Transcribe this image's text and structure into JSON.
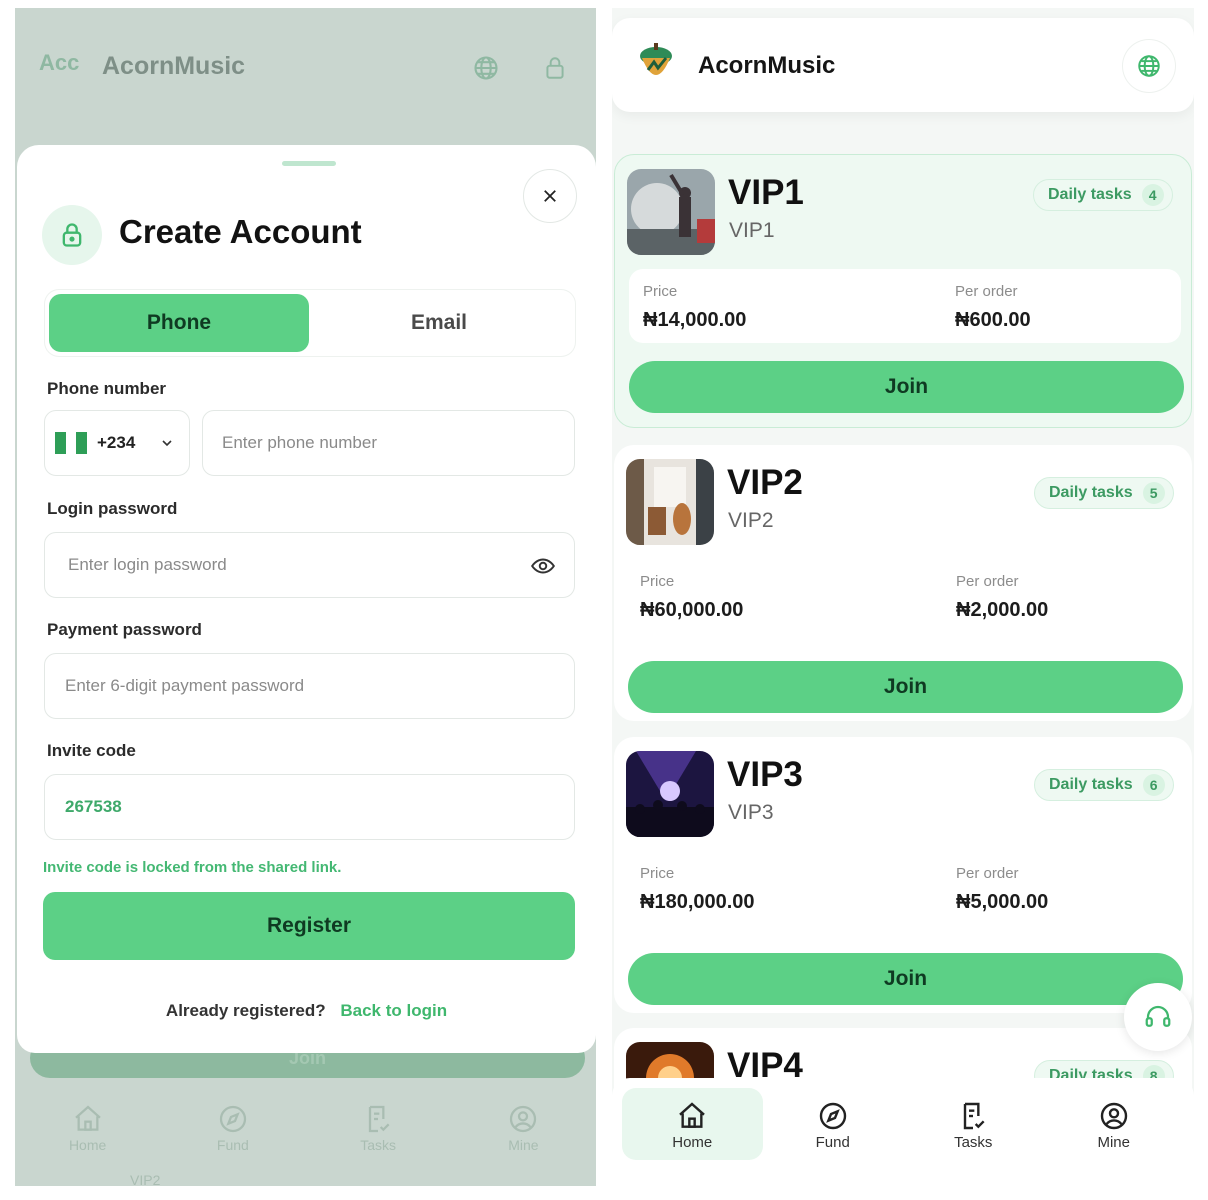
{
  "left": {
    "background": {
      "logo_text": "Acc",
      "app_title": "AcornMusic",
      "join_label": "Join",
      "nav": [
        {
          "label": "Home",
          "icon": "home-icon"
        },
        {
          "label": "Fund",
          "icon": "compass-icon"
        },
        {
          "label": "Tasks",
          "icon": "tasks-icon"
        },
        {
          "label": "Mine",
          "icon": "user-circle-icon"
        }
      ],
      "footer_text": "VIP2"
    },
    "modal": {
      "title": "Create Account",
      "tabs": [
        {
          "label": "Phone",
          "active": true
        },
        {
          "label": "Email",
          "active": false
        }
      ],
      "phone_label": "Phone number",
      "country_code": "+234",
      "phone_placeholder": "Enter phone number",
      "login_password_label": "Login password",
      "login_password_placeholder": "Enter login password",
      "payment_password_label": "Payment password",
      "payment_password_placeholder": "Enter 6-digit payment password",
      "invite_label": "Invite code",
      "invite_value": "267538",
      "invite_note": "Invite code is locked from the shared link.",
      "register_label": "Register",
      "already_text": "Already registered?",
      "back_link": "Back to login"
    }
  },
  "right": {
    "app_title": "AcornMusic",
    "cards": [
      {
        "name": "VIP1",
        "sub": "VIP1",
        "daily_label": "Daily tasks",
        "daily_count": "4",
        "price_label": "Price",
        "price": "₦14,000.00",
        "per_order_label": "Per order",
        "per_order": "₦600.00",
        "join_label": "Join"
      },
      {
        "name": "VIP2",
        "sub": "VIP2",
        "daily_label": "Daily tasks",
        "daily_count": "5",
        "price_label": "Price",
        "price": "₦60,000.00",
        "per_order_label": "Per order",
        "per_order": "₦2,000.00",
        "join_label": "Join"
      },
      {
        "name": "VIP3",
        "sub": "VIP3",
        "daily_label": "Daily tasks",
        "daily_count": "6",
        "price_label": "Price",
        "price": "₦180,000.00",
        "per_order_label": "Per order",
        "per_order": "₦5,000.00",
        "join_label": "Join"
      },
      {
        "name": "VIP4",
        "daily_label": "Daily tasks",
        "daily_count": "8"
      }
    ],
    "nav": [
      {
        "label": "Home",
        "icon": "home-icon",
        "active": true
      },
      {
        "label": "Fund",
        "icon": "compass-icon"
      },
      {
        "label": "Tasks",
        "icon": "tasks-icon"
      },
      {
        "label": "Mine",
        "icon": "user-circle-icon"
      }
    ]
  },
  "colors": {
    "accent": "#5cd086",
    "accent_text": "#3fb76d",
    "overlay": "#c9d6cf"
  }
}
